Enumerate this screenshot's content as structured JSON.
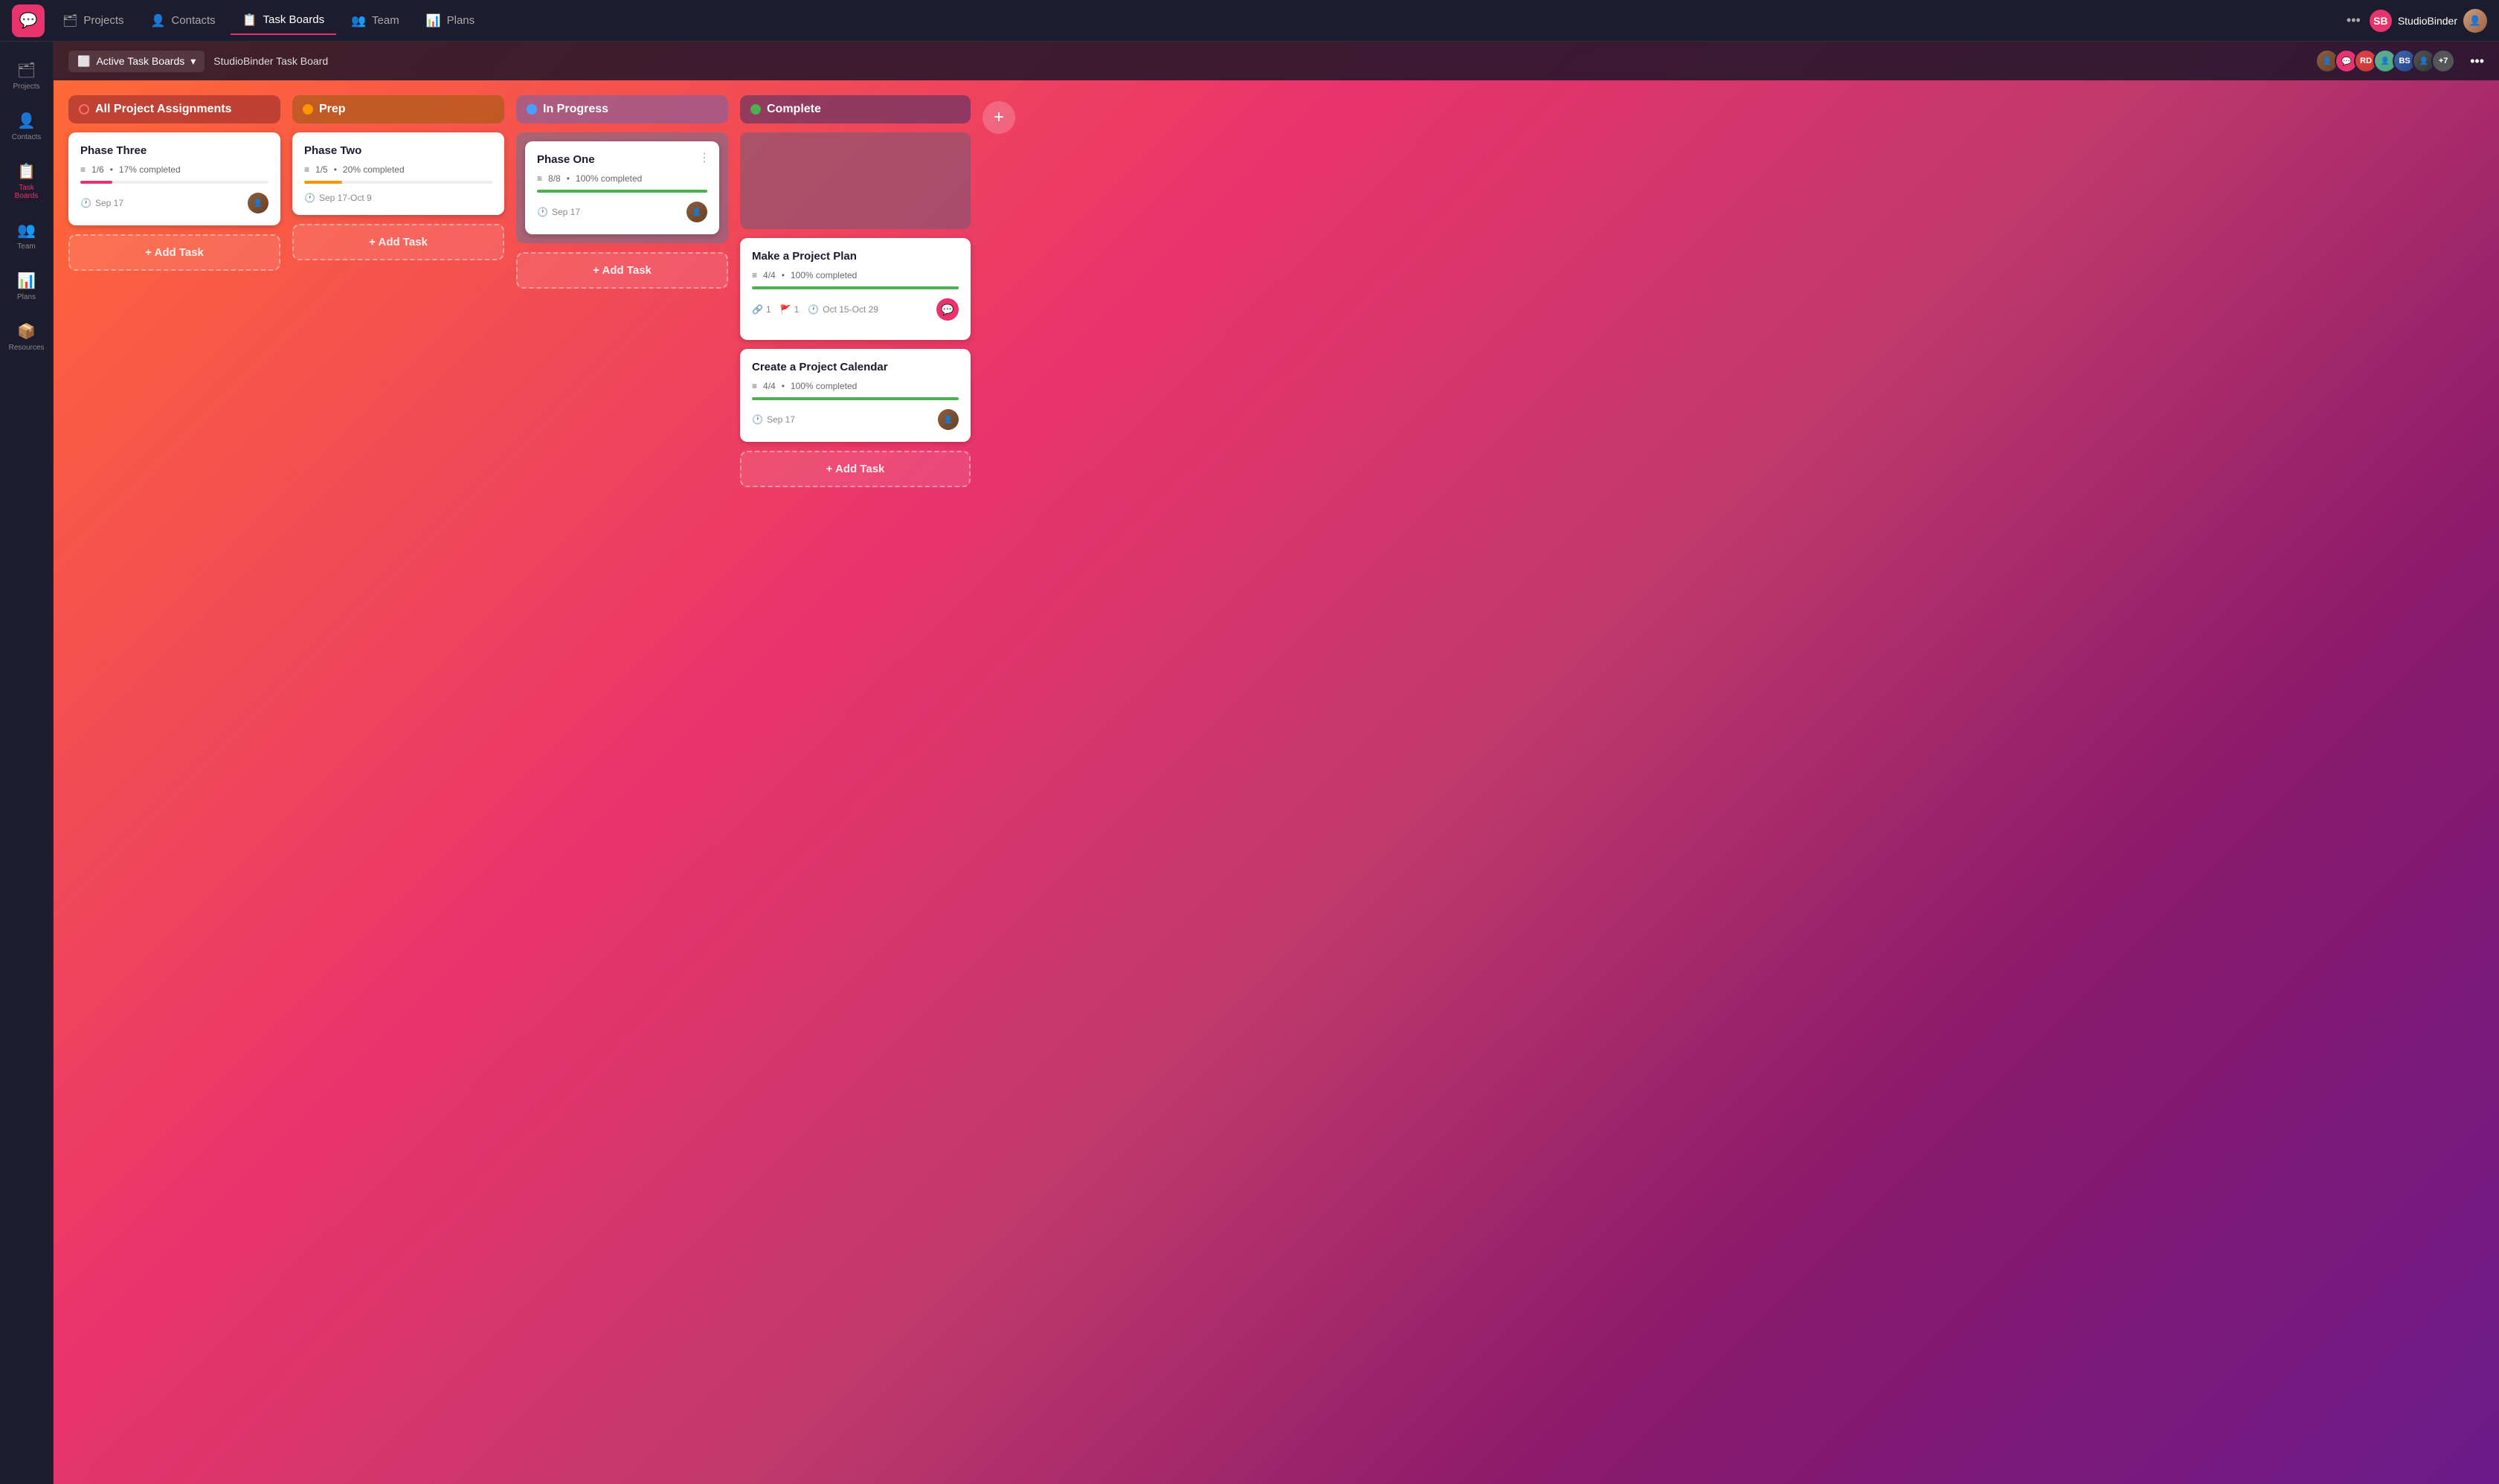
{
  "app": {
    "logo_icon": "💬",
    "title": "StudioBinder"
  },
  "topnav": {
    "items": [
      {
        "label": "Projects",
        "icon": "🗂",
        "active": false
      },
      {
        "label": "Contacts",
        "icon": "👤",
        "active": false
      },
      {
        "label": "Task Boards",
        "icon": "📋",
        "active": true
      },
      {
        "label": "Team",
        "icon": "👥",
        "active": false
      },
      {
        "label": "Plans",
        "icon": "📊",
        "active": false
      }
    ],
    "more_icon": "•••",
    "user_name": "StudioBinder"
  },
  "subheader": {
    "board_icon": "⬜",
    "board_selector": "Active Task Boards",
    "chevron": "▾",
    "board_name": "StudioBinder Task Board",
    "more_icon": "•••",
    "avatar_count": "+7"
  },
  "sidebar": {
    "items": [
      {
        "label": "Projects",
        "icon": "🗂"
      },
      {
        "label": "Contacts",
        "icon": "👤"
      },
      {
        "label": "Task Boards",
        "icon": "📋",
        "active": true
      },
      {
        "label": "Team",
        "icon": "👥"
      },
      {
        "label": "Plans",
        "icon": "📊"
      },
      {
        "label": "Resources",
        "icon": "📦"
      }
    ]
  },
  "columns": [
    {
      "id": "all",
      "title": "All Project Assignments",
      "dot_class": "dot-red",
      "header_class": "col-all",
      "cards": [
        {
          "title": "Phase Three",
          "task_count": "1/6",
          "progress_pct": "17% completed",
          "progress_width": "17",
          "progress_class": "prog-red",
          "date": "Sep 17",
          "has_avatar": true
        }
      ],
      "add_label": "+ Add Task"
    },
    {
      "id": "prep",
      "title": "Prep",
      "dot_class": "dot-orange",
      "header_class": "col-prep",
      "cards": [
        {
          "title": "Phase Two",
          "task_count": "1/5",
          "progress_pct": "20% completed",
          "progress_width": "20",
          "progress_class": "prog-orange",
          "date": "Sep 17-Oct 9",
          "has_avatar": false
        }
      ],
      "add_label": "+ Add Task"
    },
    {
      "id": "inprogress",
      "title": "In Progress",
      "dot_class": "dot-blue",
      "header_class": "col-inprogress",
      "cards": [
        {
          "title": "Phase One",
          "task_count": "8/8",
          "progress_pct": "100% completed",
          "progress_width": "100",
          "progress_class": "prog-green",
          "date": "Sep 17",
          "has_avatar": true,
          "has_dots": true
        }
      ],
      "add_label": "+ Add Task"
    },
    {
      "id": "complete",
      "title": "Complete",
      "dot_class": "dot-green",
      "header_class": "col-complete",
      "cards": [
        {
          "title": "Make a Project Plan",
          "task_count": "4/4",
          "progress_pct": "100% completed",
          "progress_width": "100",
          "progress_class": "prog-green",
          "date": "Oct 15-Oct 29",
          "has_avatar": true,
          "has_clips": true,
          "clip_count": "1",
          "link_count": "1",
          "av_pink": true
        },
        {
          "title": "Create a Project Calendar",
          "task_count": "4/4",
          "progress_pct": "100% completed",
          "progress_width": "100",
          "progress_class": "prog-green",
          "date": "Sep 17",
          "has_avatar": true
        }
      ],
      "add_label": "+ Add Task"
    }
  ],
  "add_column_label": "+",
  "status": {
    "clock_icon": "🕐",
    "tasks_icon": "≡",
    "clip_icon": "🔗",
    "flag_icon": "🚩"
  }
}
